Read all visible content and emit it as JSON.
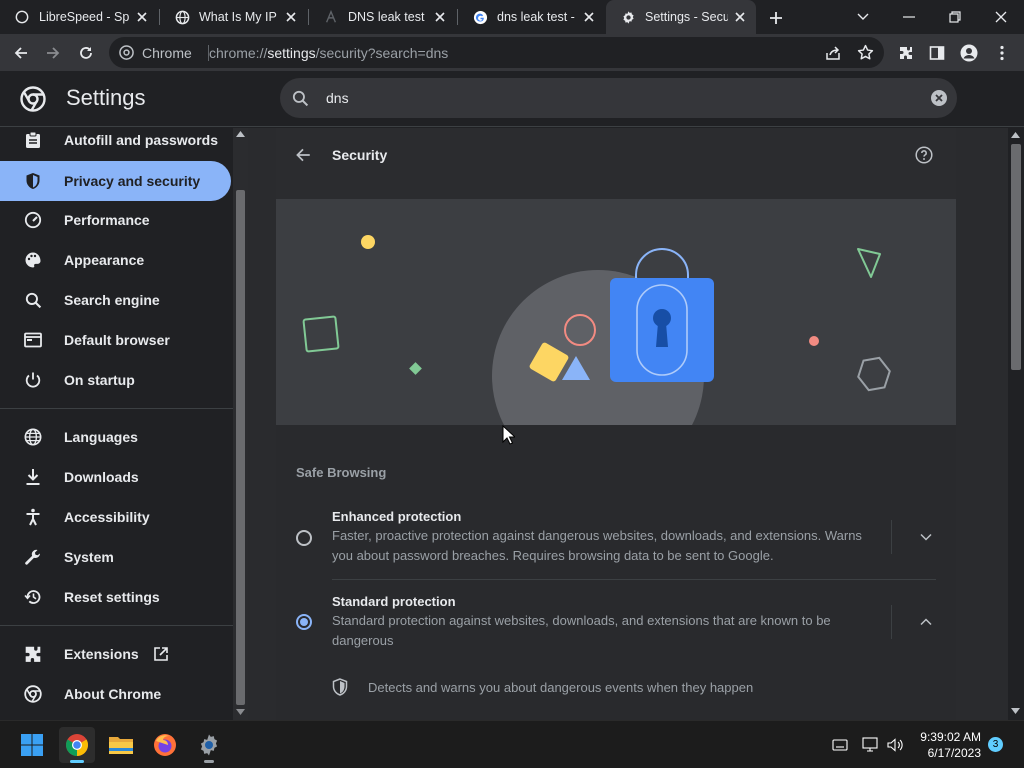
{
  "tabs": [
    {
      "title": "LibreSpeed - Sp",
      "icon": "globe-icon"
    },
    {
      "title": "What Is My IP A",
      "icon": "globe-icon"
    },
    {
      "title": "DNS leak test",
      "icon": "dnsleak-favicon-icon"
    },
    {
      "title": "dns leak test - G",
      "icon": "google-icon"
    },
    {
      "title": "Settings - Secur",
      "icon": "gear-icon",
      "active": true
    }
  ],
  "omnibox": {
    "site_label": "Chrome",
    "url_scheme": "chrome://",
    "url_host": "settings",
    "url_path": "/security?search=dns"
  },
  "settings": {
    "title": "Settings",
    "search_value": "dns"
  },
  "sidebar": {
    "items": [
      {
        "label": "Autofill and passwords",
        "icon": "clipboard-icon"
      },
      {
        "label": "Privacy and security",
        "icon": "shield-icon",
        "selected": true
      },
      {
        "label": "Performance",
        "icon": "speedometer-icon"
      },
      {
        "label": "Appearance",
        "icon": "palette-icon"
      },
      {
        "label": "Search engine",
        "icon": "search-icon"
      },
      {
        "label": "Default browser",
        "icon": "browser-window-icon"
      },
      {
        "label": "On startup",
        "icon": "power-icon"
      },
      {
        "label": "Languages",
        "icon": "globe-icon"
      },
      {
        "label": "Downloads",
        "icon": "download-icon"
      },
      {
        "label": "Accessibility",
        "icon": "accessibility-icon"
      },
      {
        "label": "System",
        "icon": "wrench-icon"
      },
      {
        "label": "Reset settings",
        "icon": "history-icon"
      },
      {
        "label": "Extensions",
        "icon": "puzzle-icon"
      },
      {
        "label": "About Chrome",
        "icon": "chrome-icon"
      }
    ]
  },
  "security": {
    "title": "Security",
    "section_label": "Safe Browsing",
    "options": [
      {
        "title": "Enhanced protection",
        "description": "Faster, proactive protection against dangerous websites, downloads, and extensions. Warns you about password breaches. Requires browsing data to be sent to Google.",
        "selected": false,
        "expanded": false
      },
      {
        "title": "Standard protection",
        "description": "Standard protection against websites, downloads, and extensions that are known to be dangerous",
        "selected": true,
        "expanded": true
      }
    ],
    "detail_text": "Detects and warns you about dangerous events when they happen"
  },
  "taskbar": {
    "time": "9:39:02 AM",
    "date": "6/17/2023",
    "notification_count": "3"
  },
  "colors": {
    "accent": "#8ab4f8",
    "background": "#202124",
    "surface": "#292a2d",
    "lock_blue": "#4285f4"
  }
}
